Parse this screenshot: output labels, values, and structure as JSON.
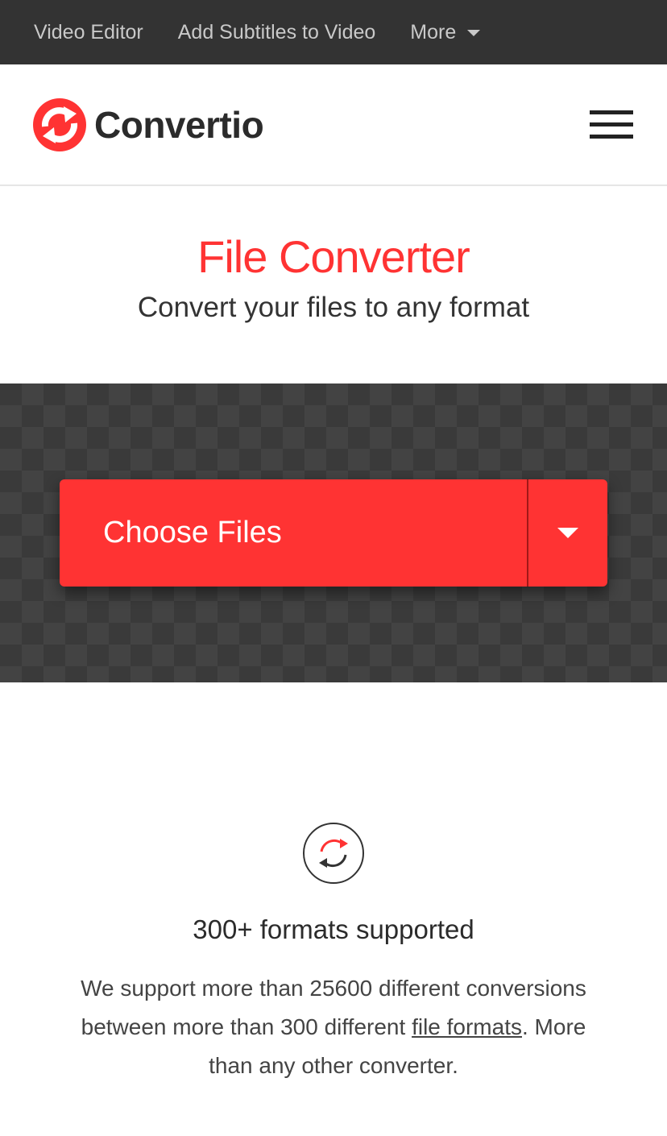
{
  "topnav": {
    "links": [
      "Video Editor",
      "Add Subtitles to Video"
    ],
    "more_label": "More"
  },
  "header": {
    "logo_text": "Convertio",
    "brand_color": "#ff3333"
  },
  "hero": {
    "title": "File Converter",
    "subtitle": "Convert your files to any format"
  },
  "upload": {
    "choose_label": "Choose Files"
  },
  "feature": {
    "icon": "convert-arrows-icon",
    "title": "300+ formats supported",
    "text_before": "We support more than 25600 different conversions between more than 300 different ",
    "link_text": "file formats",
    "text_after": ". More than any other converter."
  }
}
